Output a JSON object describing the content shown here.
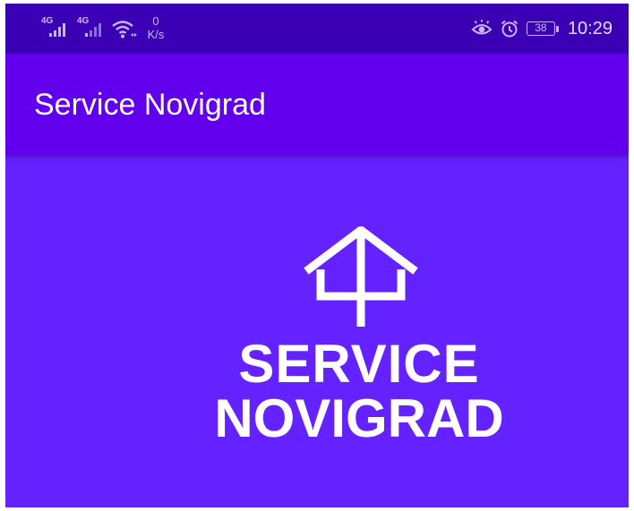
{
  "status_bar": {
    "sim1_label": "4G",
    "sim2_label": "4G",
    "net_speed_value": "0",
    "net_speed_unit": "K/s",
    "battery_level": "38",
    "time": "10:29",
    "icons": [
      "signal-icon",
      "signal-icon",
      "wifi-icon",
      "eye-comfort-icon",
      "alarm-icon",
      "battery-icon"
    ]
  },
  "toolbar": {
    "title": "Service Novigrad"
  },
  "logo": {
    "line1": "SERVICE",
    "line2": "NOVIGRAD",
    "icon": "house-logo-icon"
  },
  "colors": {
    "status_bar": "#3b00b3",
    "toolbar": "#6200ee",
    "background": "#6322ff",
    "logo": "#ffffff"
  }
}
